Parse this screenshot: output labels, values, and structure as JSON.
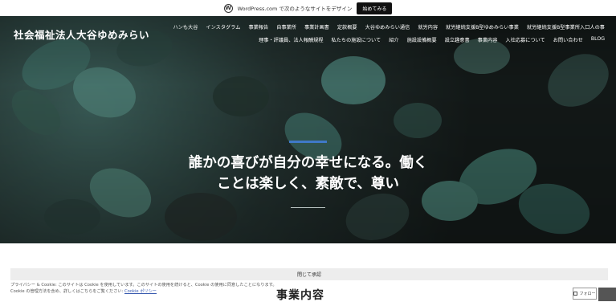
{
  "banner": {
    "logo_glyph": "W",
    "text": "WordPress.com で次のようなサイトをデザイン",
    "button_label": "始めてみる"
  },
  "site": {
    "title": "社会福祉法人大谷ゆめみらい"
  },
  "nav": {
    "row1": [
      "ハンも大谷",
      "インスタグラム",
      "事業報告",
      "自事業所",
      "事業計画書",
      "定款概要",
      "大谷ゆめみらい通信",
      "就労内容",
      "就労継続支援B型ゆめみらい事業",
      "就労継続支援B型事業所入口人の事"
    ],
    "row2": [
      "理事・評議員、法人報酬規程",
      "私たちの施設について",
      "紹介",
      "施設設備概要",
      "設立趣意書",
      "事業内容",
      "入社応募について",
      "お問い合わせ",
      "BLOG"
    ]
  },
  "hero": {
    "headline_line1": "誰かの喜びが自分の幸せになる。働く",
    "headline_line2": "ことは楽しく、素敵で、尊い",
    "accent_color": "#3f79c8"
  },
  "notice": {
    "close_label": "閉じて承認",
    "line1": "プライバシー & Cookie: このサイトは Cookie を使用しています。このサイトの使用を続けると、Cookie の使用に同意したことになります。",
    "line2_text": "Cookie の管理方法を含め、詳しくはこちらをご覧ください: ",
    "line2_link": "Cookie ポリシー"
  },
  "content": {
    "section_heading": "事業内容"
  },
  "follow": {
    "label": "フォロー"
  }
}
